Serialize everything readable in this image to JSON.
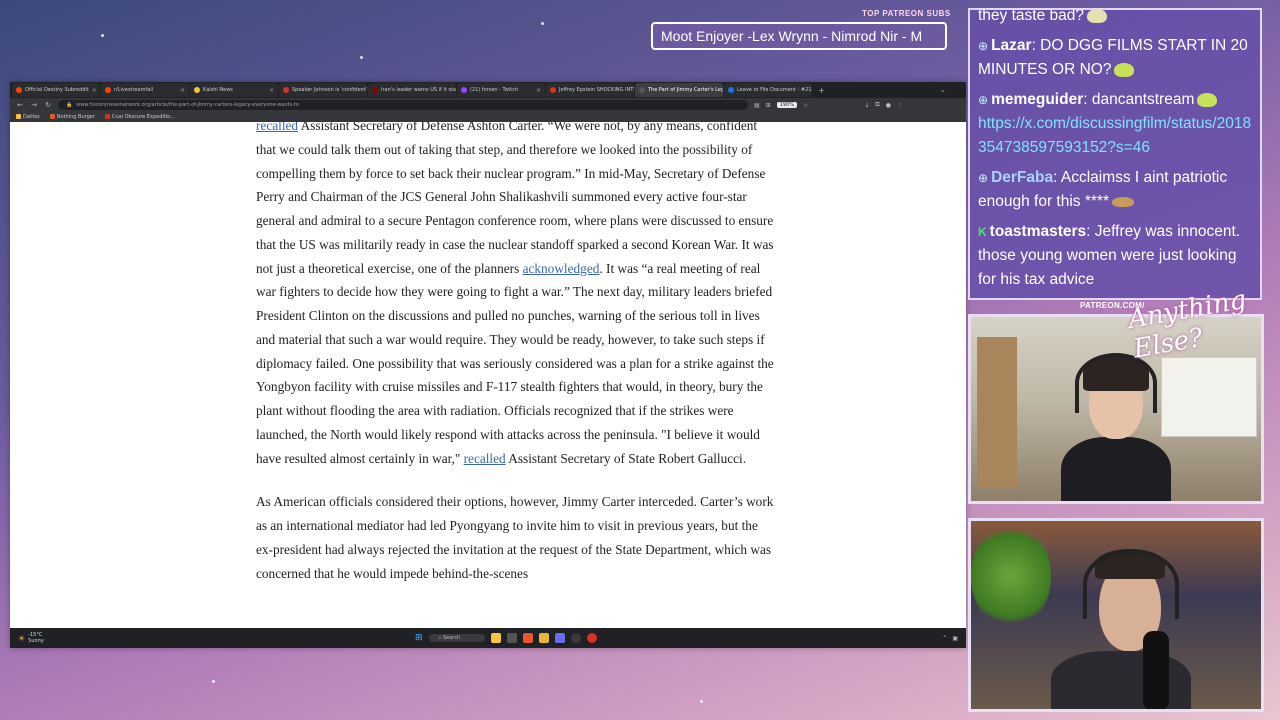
{
  "ticker": {
    "label": "TOP PATREON SUBS",
    "text": "Moot Enjoyer -Lex Wrynn - Nimrod Nir - M"
  },
  "browser": {
    "tabs": [
      {
        "label": "Official Destiny Subreddit",
        "color": "#ff4500"
      },
      {
        "label": "r/Livestreamfail",
        "color": "#ff4500"
      },
      {
        "label": "Kalshi News",
        "color": "#f5c542"
      },
      {
        "label": "Speaker Johnson is 'confident'",
        "color": "#d93025"
      },
      {
        "label": "Iran's leader warns US if it start",
        "color": "#8b0000"
      },
      {
        "label": "(21) forsen - Twitch",
        "color": "#9146ff"
      },
      {
        "label": "Jeffrey Epstein SHOCKING INTE",
        "color": "#d93025"
      },
      {
        "label": "The Part of Jimmy Carter's Legac",
        "color": "#555555",
        "active": true
      },
      {
        "label": "Leave to File Document - #214",
        "color": "#1a73e8"
      }
    ],
    "new_tab": "+",
    "tab_menu": "⌄",
    "address": "www.historynewsnetwork.org/article/the-part-of-jimmy-carters-legacy-everyone-wants-to",
    "zoom": "190%",
    "bookmarks": [
      {
        "label": "Dailies",
        "color": "#f5c542"
      },
      {
        "label": "Nothing Burger",
        "color": "#e05a2b"
      },
      {
        "label": "Cual Obscure Expeditio...",
        "color": "#d93025"
      }
    ]
  },
  "article": {
    "p1": [
      {
        "t": "recalled",
        "link": true
      },
      {
        "t": " Assistant Secretary of Defense Ashton Carter. “We were not, by any means, confident that we could talk them out of taking that step, and therefore we looked into the possibility of compelling them by force to set back their nuclear program.” In mid-May, Secretary of Defense Perry and Chairman of the JCS General John Shalikashvili summoned every active four-star general and admiral to a secure Pentagon conference room, where plans were discussed to ensure that the US was militarily ready in case the nuclear standoff sparked a second Korean War. It was not just a theoretical exercise, one of the planners "
      },
      {
        "t": "acknowledged",
        "link": true
      },
      {
        "t": ". It was “a real meeting of real war fighters to decide how they were going to fight a war.” The next day, military leaders briefed President Clinton on the discussions and pulled no punches, warning of the serious toll in lives and material that such a war would require. They would be ready, however, to take such steps if diplomacy failed. One possibility that was seriously considered was a plan for a strike against the Yongbyon facility with cruise missiles and F-117 stealth fighters that would, in theory, bury the plant without flooding the area with radiation. Officials recognized that if the strikes were launched, the North would likely respond with attacks across the peninsula. \"I believe it would have resulted almost certainly in war,\" "
      },
      {
        "t": "recalled",
        "link": true
      },
      {
        "t": " Assistant Secretary of State Robert Gallucci."
      }
    ],
    "p2": "As American officials considered their options, however, Jimmy Carter interceded. Carter’s work as an international mediator had led Pyongyang to invite him to visit in previous years, but the ex-president had always rejected the invitation at the request of the State Department, which was concerned that he would impede behind-the-scenes"
  },
  "taskbar": {
    "weather_temp": "-15°C",
    "weather_desc": "Sunny",
    "search": "Search"
  },
  "chat": {
    "messages": [
      {
        "badge": "",
        "user": "",
        "text": "they taste bad?",
        "emote": "pale"
      },
      {
        "badge": "⊕",
        "user": "Lazar",
        "text": ": DO DGG FILMS START IN 20 MINUTES OR NO?",
        "emote": "green"
      },
      {
        "badge": "⊕",
        "user": "memeguider",
        "text": ": dancantstream",
        "emote": "green",
        "link": "https://x.com/discussingfilm/status/2018354738597593152?s=46"
      },
      {
        "badge": "⊕",
        "user": "DerFaba",
        "user_color": "blue",
        "text": ": Acclaimss I aint patriotic enough for this ****",
        "emote": "brown"
      },
      {
        "badge": "K",
        "badge_color": "green",
        "user": "toastmasters",
        "text": ": Jeffrey was innocent. those young women were just looking for his tax advice"
      }
    ]
  },
  "cams": {
    "patreon_url": "PATREON.COM/",
    "overlay_script": "Anything Else?"
  }
}
